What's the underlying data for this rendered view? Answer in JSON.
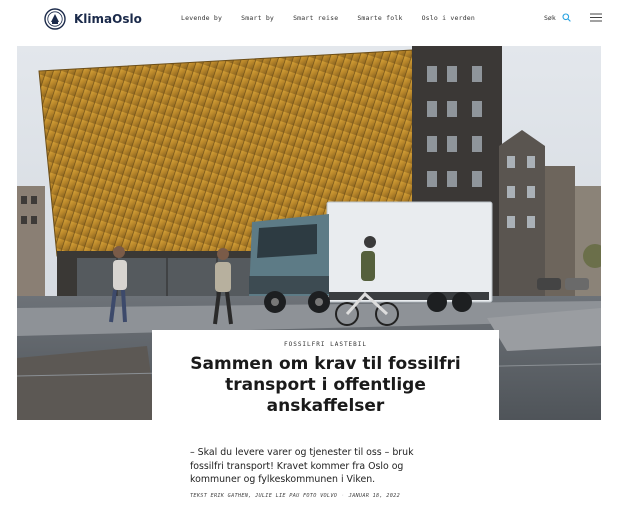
{
  "header": {
    "logo_text": "KlimaOslo",
    "nav": [
      "Levende by",
      "Smart by",
      "Smart reise",
      "Smarte folk",
      "Oslo i verden"
    ],
    "search_label": "Søk",
    "accent": "#2aa3e0"
  },
  "article": {
    "kicker": "FOSSILFRI LASTEBIL",
    "title": "Sammen om krav til fossilfri transport i offentlige anskaffelser",
    "lead": "– Skal du levere varer og tjenester til oss – bruk fossilfri transport! Kravet kommer fra Oslo og kommuner og fylkeskommunen i Viken.",
    "byline_authors": "TEKST ERIK GATHEN, JULIE LIE PAU FOTO VOLVO",
    "byline_date": "JANUAR 18, 2022"
  },
  "icons": {
    "logo": "city-crest-icon",
    "search": "search-icon",
    "menu": "hamburger-menu-icon"
  }
}
